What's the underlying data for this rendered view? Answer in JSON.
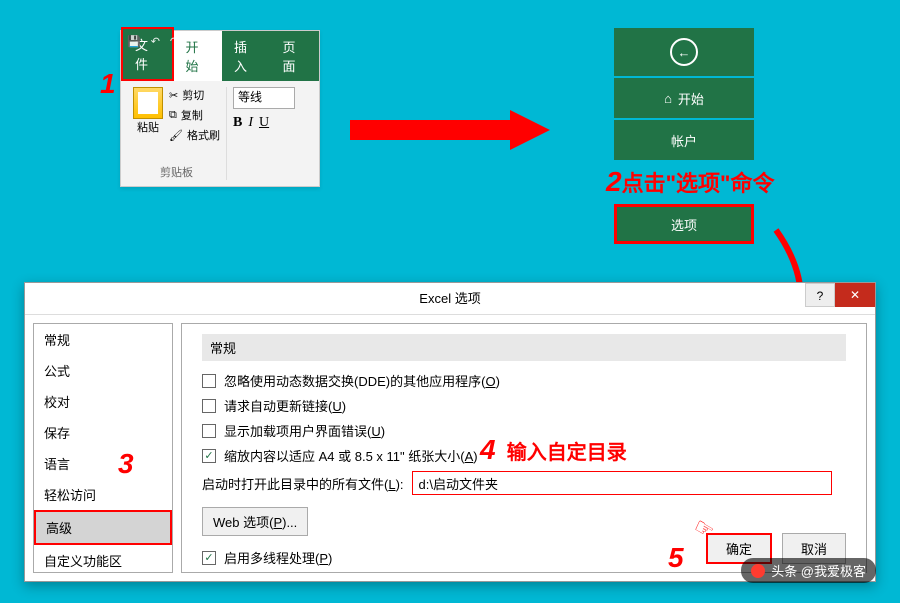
{
  "ribbon": {
    "tabs": {
      "file": "文件",
      "home": "开始",
      "insert": "插入",
      "layout": "页面"
    },
    "clipboard": {
      "paste": "粘贴",
      "cut": "剪切",
      "copy": "复制",
      "format_painter": "格式刷",
      "group_label": "剪贴板"
    },
    "font": {
      "name": "等线",
      "bold": "B",
      "italic": "I",
      "underline": "U"
    }
  },
  "backstage": {
    "home": "开始",
    "account": "帐户",
    "options": "选项"
  },
  "annotations": {
    "step1": "1",
    "step2_num": "2",
    "step2_text": "点击\"选项\"命令",
    "step3": "3",
    "step4_num": "4",
    "step4_text": "输入自定目录",
    "step5": "5"
  },
  "dialog": {
    "title": "Excel 选项",
    "help": "?",
    "close": "✕",
    "sidebar": [
      "常规",
      "公式",
      "校对",
      "保存",
      "语言",
      "轻松访问",
      "高级",
      "自定义功能区"
    ],
    "selected_index": 6,
    "content": {
      "section": "常规",
      "opt1": "忽略使用动态数据交换(DDE)的其他应用程序(",
      "opt1_key": "O",
      "opt2": "请求自动更新链接(",
      "opt2_key": "U",
      "opt3": "显示加载项用户界面错误(",
      "opt3_key": "U",
      "opt4": "缩放内容以适应 A4 或 8.5 x 11\" 纸张大小(",
      "opt4_key": "A",
      "path_label": "启动时打开此目录中的所有文件(",
      "path_key": "L",
      "path_suffix": "):",
      "path_value": "d:\\启动文件夹",
      "web_btn": "Web 选项(",
      "web_key": "P",
      "web_suffix": ")...",
      "opt5": "启用多线程处理(",
      "opt5_key": "P"
    },
    "buttons": {
      "ok": "确定",
      "cancel": "取消"
    }
  },
  "watermark": "头条 @我爱极客"
}
